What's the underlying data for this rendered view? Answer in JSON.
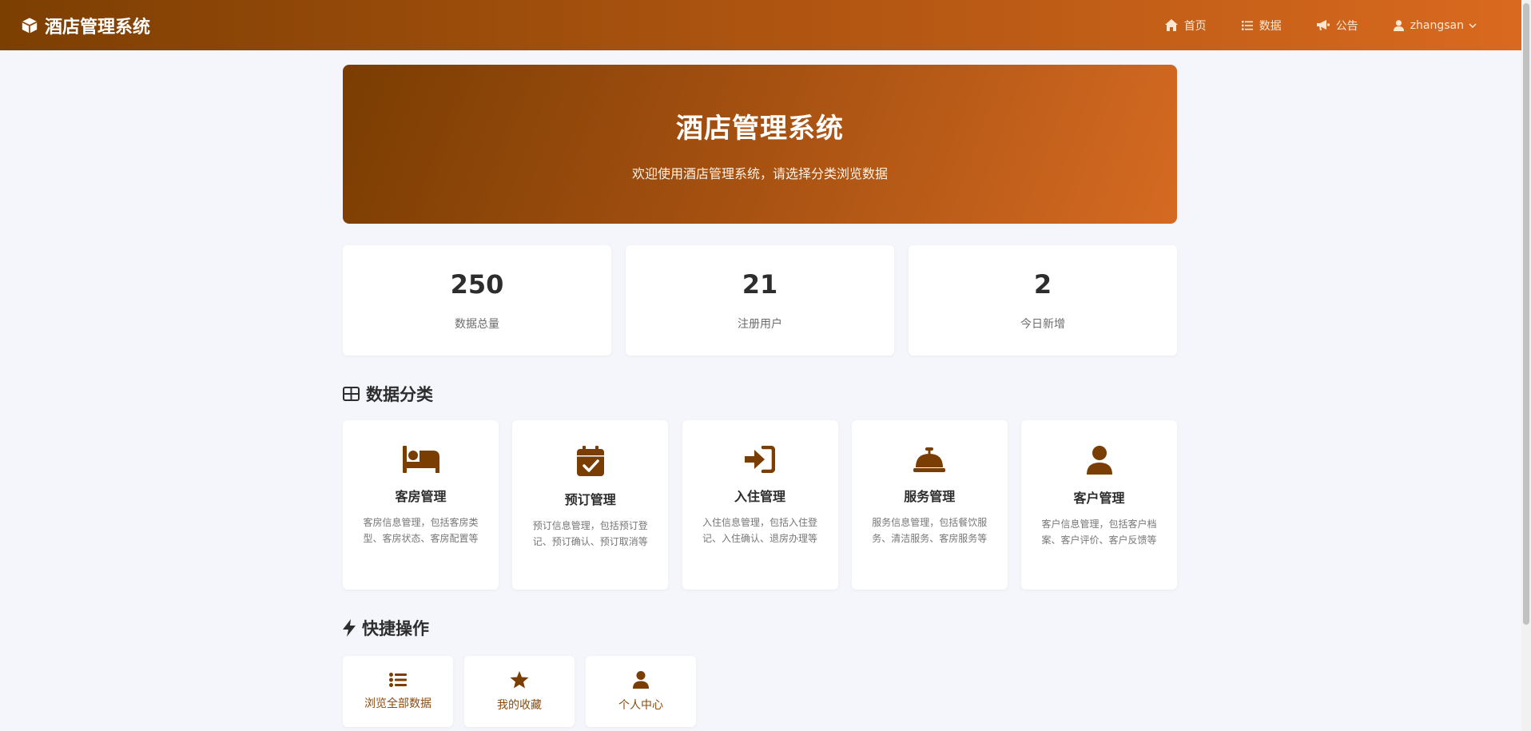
{
  "nav": {
    "brand": "酒店管理系统",
    "links": [
      {
        "label": "首页",
        "icon": "home-icon"
      },
      {
        "label": "数据",
        "icon": "list-icon"
      },
      {
        "label": "公告",
        "icon": "megaphone-icon"
      }
    ],
    "user": "zhangsan"
  },
  "hero": {
    "title": "酒店管理系统",
    "subtitle": "欢迎使用酒店管理系统，请选择分类浏览数据"
  },
  "stats": [
    {
      "value": "250",
      "label": "数据总量"
    },
    {
      "value": "21",
      "label": "注册用户"
    },
    {
      "value": "2",
      "label": "今日新增"
    }
  ],
  "categories_section": {
    "title": "数据分类",
    "items": [
      {
        "title": "客房管理",
        "desc": "客房信息管理，包括客房类型、客房状态、客房配置等",
        "icon": "bed-icon"
      },
      {
        "title": "预订管理",
        "desc": "预订信息管理，包括预订登记、预订确认、预订取消等",
        "icon": "calendar-check-icon"
      },
      {
        "title": "入住管理",
        "desc": "入住信息管理，包括入住登记、入住确认、退房办理等",
        "icon": "sign-in-icon"
      },
      {
        "title": "服务管理",
        "desc": "服务信息管理，包括餐饮服务、清洁服务、客房服务等",
        "icon": "service-bell-icon"
      },
      {
        "title": "客户管理",
        "desc": "客户信息管理，包括客户档案、客户评价、客户反馈等",
        "icon": "user-icon"
      }
    ]
  },
  "quick_section": {
    "title": "快捷操作",
    "items": [
      {
        "label": "浏览全部数据",
        "icon": "list-icon"
      },
      {
        "label": "我的收藏",
        "icon": "star-icon"
      },
      {
        "label": "个人中心",
        "icon": "user-icon"
      }
    ]
  },
  "colors": {
    "brand_dark": "#7c3f02",
    "brand_light": "#d9691f",
    "icon": "#7a3d02",
    "background": "#f4f6fb"
  }
}
